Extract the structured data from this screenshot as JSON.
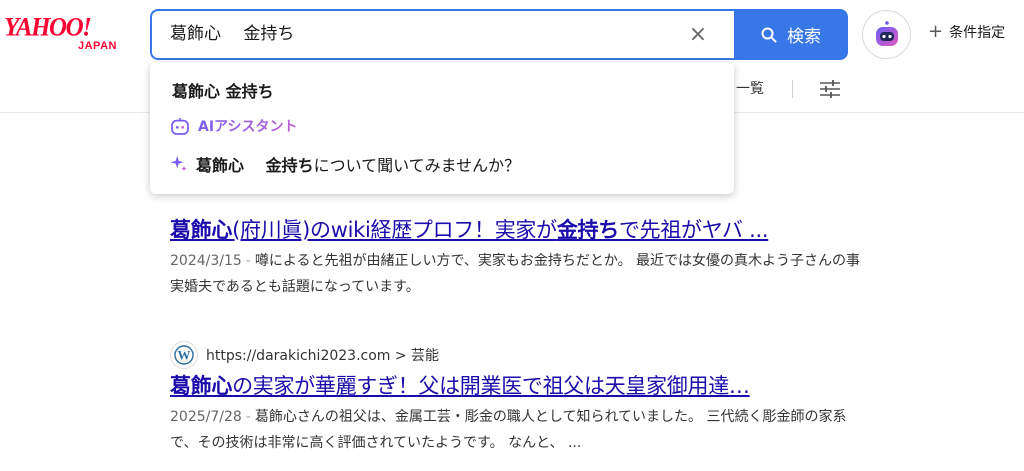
{
  "header": {
    "logo_main": "YAHOO!",
    "logo_sub": "JAPAN",
    "search_value": "葛飾心　 金持ち",
    "clear_glyph": "×",
    "search_button_label": "検索",
    "conditions_label": "条件指定",
    "plus_glyph": "+"
  },
  "tabs": {
    "list_label": "一覧"
  },
  "dropdown": {
    "suggestion": "葛飾心 金持ち",
    "ai_label": "AIアシスタント",
    "ask_bold": "葛飾心　 金持ち",
    "ask_rest": "について聞いてみませんか？"
  },
  "results": [
    {
      "site": "",
      "title_parts": [
        {
          "text": "葛飾心",
          "bold": true
        },
        {
          "text": "(府川眞)のwiki経歴プロフ！実家が",
          "bold": false
        },
        {
          "text": "金持ち",
          "bold": true
        },
        {
          "text": "で先祖がヤバ ...",
          "bold": false
        }
      ],
      "date": "2024/3/15",
      "snippet": "噂によると先祖が由緒正しい方で、実家もお金持ちだとか。 最近では女優の真木よう子さんの事実婚夫であるとも話題になっています。"
    },
    {
      "site": "https://darakichi2023.com > 芸能",
      "title_parts": [
        {
          "text": "葛飾心",
          "bold": true
        },
        {
          "text": "の実家が華麗すぎ！父は開業医で祖父は天皇家御用達…",
          "bold": false
        }
      ],
      "date": "2025/7/28",
      "snippet": "葛飾心さんの祖父は、金属工芸・彫金の職人として知られていました。 三代続く彫金師の家系で、その技術は非常に高く評価されていたようです。 なんと、 ..."
    }
  ],
  "colors": {
    "brand": "#ff0033",
    "accent": "#3877e8",
    "link": "#1a0dab",
    "ai": "#8a4fe8"
  }
}
